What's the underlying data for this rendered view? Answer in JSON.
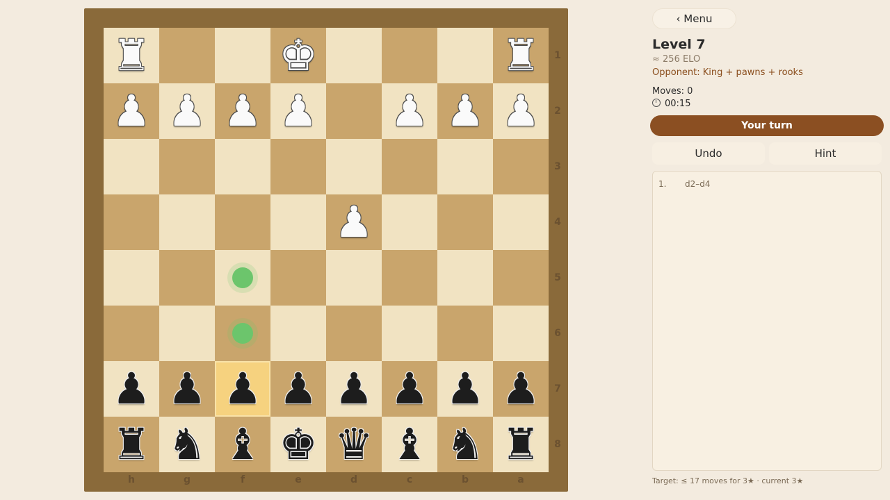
{
  "board": {
    "ranks": [
      "1",
      "2",
      "3",
      "4",
      "5",
      "6",
      "7",
      "8"
    ],
    "files": [
      "h",
      "g",
      "f",
      "e",
      "d",
      "c",
      "b",
      "a"
    ],
    "pieces": [
      {
        "square": "h1",
        "glyph": "♜",
        "color": "white",
        "name": "white-rook"
      },
      {
        "square": "e1",
        "glyph": "♚",
        "color": "white",
        "name": "white-king"
      },
      {
        "square": "a1",
        "glyph": "♜",
        "color": "white",
        "name": "white-rook"
      },
      {
        "square": "h2",
        "glyph": "♟",
        "color": "white",
        "name": "white-pawn"
      },
      {
        "square": "g2",
        "glyph": "♟",
        "color": "white",
        "name": "white-pawn"
      },
      {
        "square": "f2",
        "glyph": "♟",
        "color": "white",
        "name": "white-pawn"
      },
      {
        "square": "e2",
        "glyph": "♟",
        "color": "white",
        "name": "white-pawn"
      },
      {
        "square": "c2",
        "glyph": "♟",
        "color": "white",
        "name": "white-pawn"
      },
      {
        "square": "b2",
        "glyph": "♟",
        "color": "white",
        "name": "white-pawn"
      },
      {
        "square": "a2",
        "glyph": "♟",
        "color": "white",
        "name": "white-pawn"
      },
      {
        "square": "d4",
        "glyph": "♟",
        "color": "white",
        "name": "white-pawn"
      },
      {
        "square": "h7",
        "glyph": "♟",
        "color": "black",
        "name": "black-pawn"
      },
      {
        "square": "g7",
        "glyph": "♟",
        "color": "black",
        "name": "black-pawn"
      },
      {
        "square": "f7",
        "glyph": "♟",
        "color": "black",
        "name": "black-pawn"
      },
      {
        "square": "e7",
        "glyph": "♟",
        "color": "black",
        "name": "black-pawn"
      },
      {
        "square": "d7",
        "glyph": "♟",
        "color": "black",
        "name": "black-pawn"
      },
      {
        "square": "c7",
        "glyph": "♟",
        "color": "black",
        "name": "black-pawn"
      },
      {
        "square": "b7",
        "glyph": "♟",
        "color": "black",
        "name": "black-pawn"
      },
      {
        "square": "a7",
        "glyph": "♟",
        "color": "black",
        "name": "black-pawn"
      },
      {
        "square": "h8",
        "glyph": "♜",
        "color": "black",
        "name": "black-rook"
      },
      {
        "square": "g8",
        "glyph": "♞",
        "color": "black",
        "name": "black-knight"
      },
      {
        "square": "f8",
        "glyph": "♝",
        "color": "black",
        "name": "black-bishop"
      },
      {
        "square": "e8",
        "glyph": "♚",
        "color": "black",
        "name": "black-king"
      },
      {
        "square": "d8",
        "glyph": "♛",
        "color": "black",
        "name": "black-queen"
      },
      {
        "square": "c8",
        "glyph": "♝",
        "color": "black",
        "name": "black-bishop"
      },
      {
        "square": "b8",
        "glyph": "♞",
        "color": "black",
        "name": "black-knight"
      },
      {
        "square": "a8",
        "glyph": "♜",
        "color": "black",
        "name": "black-rook"
      }
    ],
    "selected": "f7",
    "legal_moves": [
      "f5",
      "f6"
    ],
    "colors": {
      "light": "#f1e3c2",
      "dark": "#c9a56c",
      "frame": "#8a6a3a",
      "selected": "#f6d27f",
      "hint": "#6cc56c"
    }
  },
  "panel": {
    "menu_label": "‹ Menu",
    "level_title": "Level 7",
    "elo": "≈ 256 ELO",
    "opponent": "Opponent: King + pawns + rooks",
    "moves": "Moves: 0",
    "timer": "00:15",
    "turn": "Your turn",
    "undo_label": "Undo",
    "hint_label": "Hint",
    "move_list": [
      {
        "num": "1.",
        "move": "d2–d4"
      }
    ],
    "target_note": "Target: ≤ 17 moves for 3★ · current 3★",
    "accent": "#8b4f22"
  }
}
